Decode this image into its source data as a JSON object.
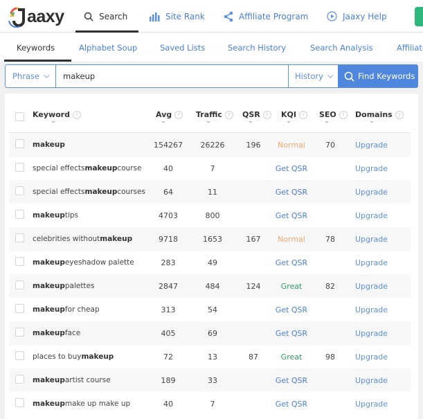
{
  "app": {
    "logo_text": "aaxy",
    "colors": {
      "accent": "#4f87dd",
      "link": "#4a7fd8",
      "normal": "#f4a86b",
      "great": "#2f9f63",
      "green_button": "#2fb67a"
    }
  },
  "topnav": [
    {
      "label": "Search",
      "icon": "search-icon",
      "active": true
    },
    {
      "label": "Site Rank",
      "icon": "bar-chart-icon",
      "active": false
    },
    {
      "label": "Affiliate Program",
      "icon": "share-icon",
      "active": false
    },
    {
      "label": "Jaaxy Help",
      "icon": "play-circle-icon",
      "active": false
    }
  ],
  "subnav": [
    {
      "label": "Keywords",
      "active": true
    },
    {
      "label": "Alphabet Soup",
      "active": false
    },
    {
      "label": "Saved Lists",
      "active": false
    },
    {
      "label": "Search History",
      "active": false
    },
    {
      "label": "Search Analysis",
      "active": false
    },
    {
      "label": "Affiliate",
      "active": false
    }
  ],
  "search": {
    "mode": "Phrase",
    "value": "makeup",
    "history_label": "History",
    "button_label": "Find Keywords"
  },
  "table": {
    "columns": [
      "Keyword",
      "Avg",
      "Traffic",
      "QSR",
      "KQI",
      "SEO",
      "Domains"
    ],
    "rows": [
      {
        "pre": "",
        "bold": "makeup",
        "post": "",
        "avg": "154267",
        "traffic": "26226",
        "qsr": "196",
        "kqi": "Normal",
        "kqi_type": "normal",
        "seo": "70",
        "domains": "Upgrade"
      },
      {
        "pre": "special effects ",
        "bold": "makeup",
        "post": " course",
        "avg": "40",
        "traffic": "7",
        "qsr": "",
        "kqi": "Get QSR",
        "kqi_type": "link",
        "seo": "",
        "domains": "Upgrade"
      },
      {
        "pre": "special effects ",
        "bold": "makeup",
        "post": " courses",
        "avg": "64",
        "traffic": "11",
        "qsr": "",
        "kqi": "Get QSR",
        "kqi_type": "link",
        "seo": "",
        "domains": "Upgrade"
      },
      {
        "pre": "",
        "bold": "makeup",
        "post": " tips",
        "avg": "4703",
        "traffic": "800",
        "qsr": "",
        "kqi": "Get QSR",
        "kqi_type": "link",
        "seo": "",
        "domains": "Upgrade"
      },
      {
        "pre": "celebrities without ",
        "bold": "makeup",
        "post": "",
        "avg": "9718",
        "traffic": "1653",
        "qsr": "167",
        "kqi": "Normal",
        "kqi_type": "normal",
        "seo": "78",
        "domains": "Upgrade"
      },
      {
        "pre": "",
        "bold": "makeup",
        "post": " eyeshadow palette",
        "avg": "283",
        "traffic": "49",
        "qsr": "",
        "kqi": "Get QSR",
        "kqi_type": "link",
        "seo": "",
        "domains": "Upgrade"
      },
      {
        "pre": "",
        "bold": "makeup",
        "post": " palettes",
        "avg": "2847",
        "traffic": "484",
        "qsr": "124",
        "kqi": "Great",
        "kqi_type": "great",
        "seo": "82",
        "domains": "Upgrade"
      },
      {
        "pre": "",
        "bold": "makeup",
        "post": " for cheap",
        "avg": "313",
        "traffic": "54",
        "qsr": "",
        "kqi": "Get QSR",
        "kqi_type": "link",
        "seo": "",
        "domains": "Upgrade"
      },
      {
        "pre": "",
        "bold": "makeup",
        "post": " face",
        "avg": "405",
        "traffic": "69",
        "qsr": "",
        "kqi": "Get QSR",
        "kqi_type": "link",
        "seo": "",
        "domains": "Upgrade"
      },
      {
        "pre": "places to buy ",
        "bold": "makeup",
        "post": "",
        "avg": "72",
        "traffic": "13",
        "qsr": "87",
        "kqi": "Great",
        "kqi_type": "great",
        "seo": "98",
        "domains": "Upgrade"
      },
      {
        "pre": "",
        "bold": "makeup",
        "post": " artist course",
        "avg": "189",
        "traffic": "33",
        "qsr": "",
        "kqi": "Get QSR",
        "kqi_type": "link",
        "seo": "",
        "domains": "Upgrade"
      },
      {
        "pre": "",
        "bold": "makeup",
        "post": " make up make up",
        "avg": "40",
        "traffic": "7",
        "qsr": "",
        "kqi": "Get QSR",
        "kqi_type": "link",
        "seo": "",
        "domains": "Upgrade"
      }
    ]
  }
}
